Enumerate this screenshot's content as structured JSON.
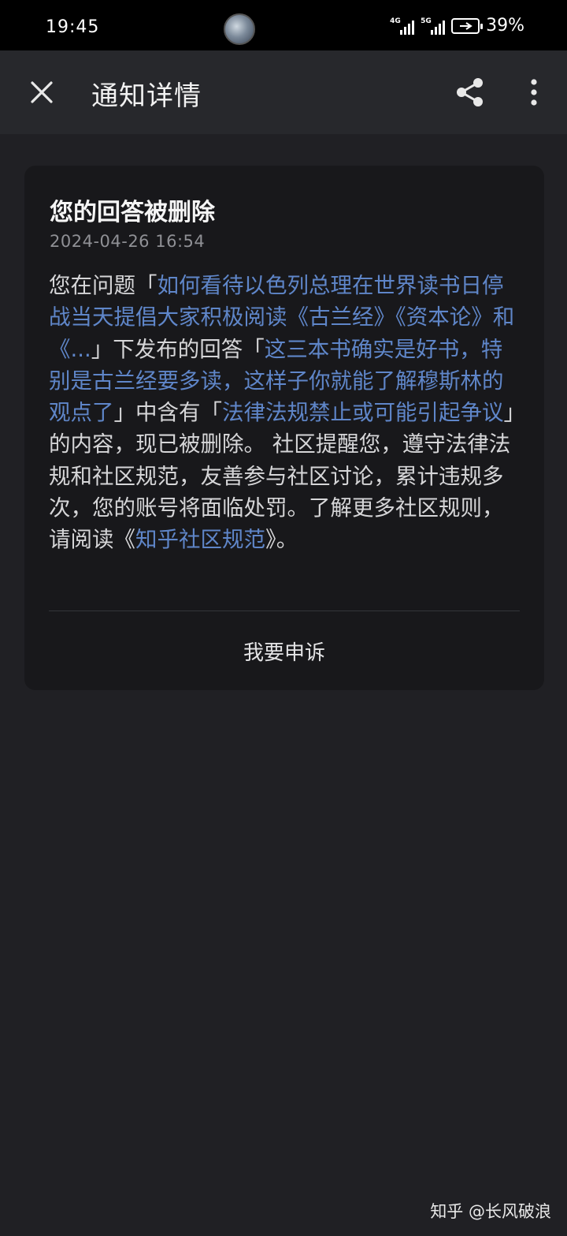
{
  "status_bar": {
    "time": "19:45",
    "signal1": "4G",
    "signal2": "5G",
    "battery_pct": "39%"
  },
  "app_bar": {
    "title": "通知详情"
  },
  "card": {
    "title": "您的回答被删除",
    "timestamp": "2024-04-26 16:54",
    "body": {
      "t1": "您在问题「",
      "question_link": "如何看待以色列总理在世界读书日停战当天提倡大家积极阅读《古兰经》《资本论》和《...",
      "t2": "」下发布的回答「",
      "answer_link": "这三本书确实是好书，特别是古兰经要多读，这样子你就能了解穆斯林的观点了",
      "t3": "」中含有「",
      "reason_link": "法律法规禁止或可能引起争议",
      "t4": "」的内容，现已被删除。 社区提醒您，遵守法律法规和社区规范，友善参与社区讨论，累计违规多次，您的账号将面临处罚。了解更多社区规则，请阅读《",
      "rules_link": "知乎社区规范",
      "t5": "》。"
    },
    "appeal_label": "我要申诉"
  },
  "watermark": "知乎 @长风破浪",
  "colors": {
    "background": "#202024",
    "card": "#18181b",
    "link": "#5f86c9"
  }
}
